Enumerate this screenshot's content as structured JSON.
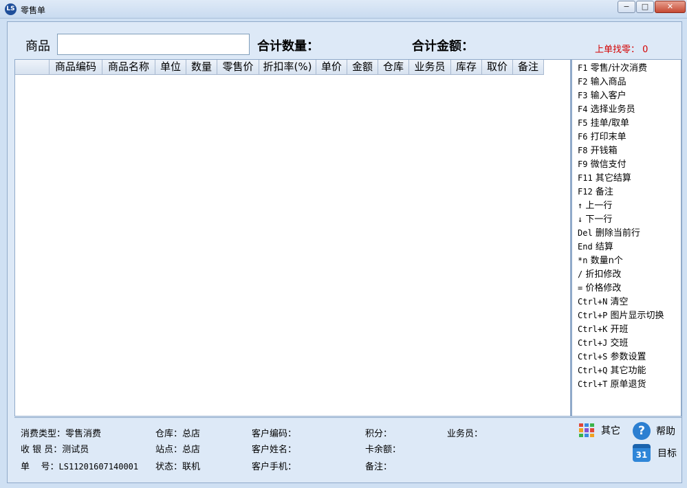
{
  "window": {
    "title": "零售单",
    "app_icon": "LS",
    "min": "−",
    "max": "□",
    "close": "✕"
  },
  "toolbar": {
    "goods_label": "商品",
    "goods_value": "",
    "total_qty_label": "合计数量：",
    "total_amt_label": "合计金额：",
    "last_change": "上单找零： 0"
  },
  "grid": {
    "columns": [
      "",
      "商品编码",
      "商品名称",
      "单位",
      "数量",
      "零售价",
      "折扣率(%)",
      "单价",
      "金额",
      "仓库",
      "业务员",
      "库存",
      "取价",
      "备注"
    ]
  },
  "shortcuts": [
    {
      "key": "F1",
      "label": "零售/计次消费"
    },
    {
      "key": "F2",
      "label": "输入商品"
    },
    {
      "key": "F3",
      "label": "输入客户"
    },
    {
      "key": "F4",
      "label": "选择业务员"
    },
    {
      "key": "F5",
      "label": "挂单/取单"
    },
    {
      "key": "F6",
      "label": "打印末单"
    },
    {
      "key": "F8",
      "label": "开钱箱"
    },
    {
      "key": "F9",
      "label": "微信支付"
    },
    {
      "key": "F11",
      "label": "其它结算"
    },
    {
      "key": "F12",
      "label": "备注"
    },
    {
      "key": "↑",
      "label": "上一行"
    },
    {
      "key": "↓",
      "label": "下一行"
    },
    {
      "key": "Del",
      "label": "删除当前行"
    },
    {
      "key": "End",
      "label": "结算"
    },
    {
      "key": "*n",
      "label": " 数量n个"
    },
    {
      "key": "/",
      "label": "折扣修改"
    },
    {
      "key": "=",
      "label": "价格修改"
    },
    {
      "key": "Ctrl+N",
      "label": "清空"
    },
    {
      "key": "Ctrl+P",
      "label": "图片显示切换"
    },
    {
      "key": "Ctrl+K",
      "label": "开班"
    },
    {
      "key": "Ctrl+J",
      "label": "交班"
    },
    {
      "key": "Ctrl+S",
      "label": "参数设置"
    },
    {
      "key": "Ctrl+Q",
      "label": "其它功能"
    },
    {
      "key": "Ctrl+T",
      "label": "原单退货"
    }
  ],
  "footer": {
    "consume_type_label": "消费类型：",
    "consume_type": "零售消费",
    "cashier_label": "收 银 员：",
    "cashier": "测试员",
    "order_no_label": "单    号：",
    "order_no": "LS11201607140001",
    "warehouse_label": "仓库：",
    "warehouse": "总店",
    "site_label": "站点：",
    "site": "总店",
    "status_label": "状态：",
    "status": "联机",
    "cust_code_label": "客户编码：",
    "cust_name_label": "客户姓名：",
    "cust_phone_label": "客户手机：",
    "points_label": "积分：",
    "card_balance_label": "卡余额：",
    "remark_label": "备注：",
    "salesman_label": "业务员：",
    "other_btn": "其它",
    "help_btn": "帮助",
    "target_btn": "目标",
    "calendar_day": "31",
    "colors": {
      "tile1": "#e0463a",
      "tile2": "#3a8be0",
      "tile3": "#3bb34a",
      "tile4": "#f0a020",
      "accent_red": "#d40000"
    }
  }
}
